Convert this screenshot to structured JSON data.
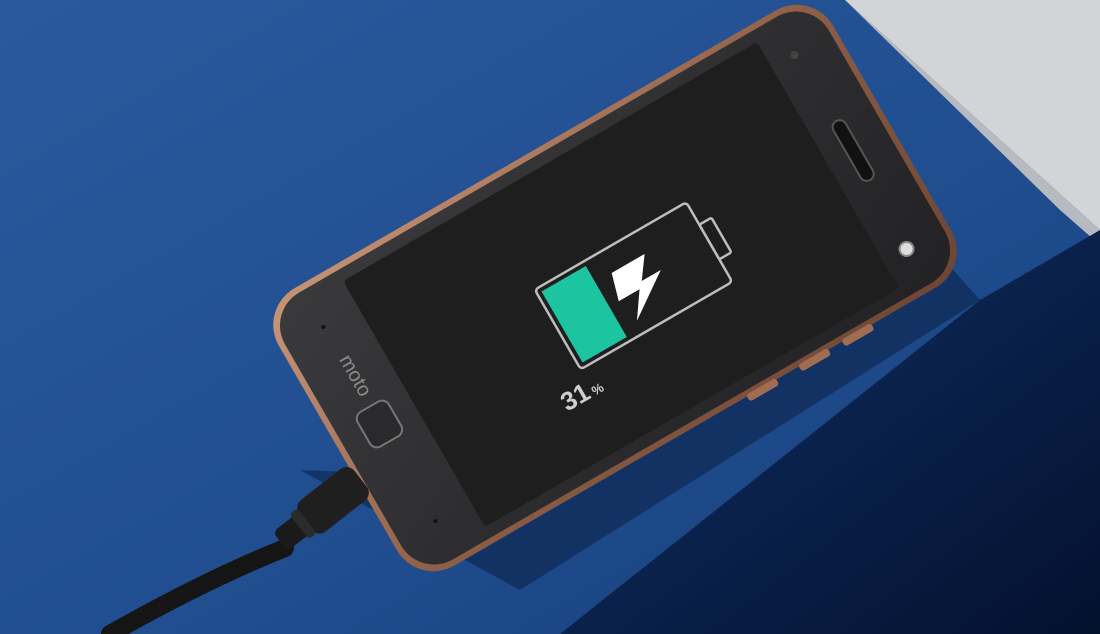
{
  "colors": {
    "background_blue": "#22508f",
    "surface_dark_blue": "#0b2a5c",
    "gray_wall": "#cfd2d6",
    "phone_frame": "#a8745a",
    "phone_body": "#2c2c2e",
    "screen": "#1f1f20",
    "battery_fill": "#1dc4a0",
    "cable": "#141414"
  },
  "phone": {
    "brand_logo": "moto"
  },
  "battery": {
    "level_percent": 31,
    "percent_number": "31",
    "percent_sign": "%",
    "icon": "charging-bolt-icon"
  }
}
